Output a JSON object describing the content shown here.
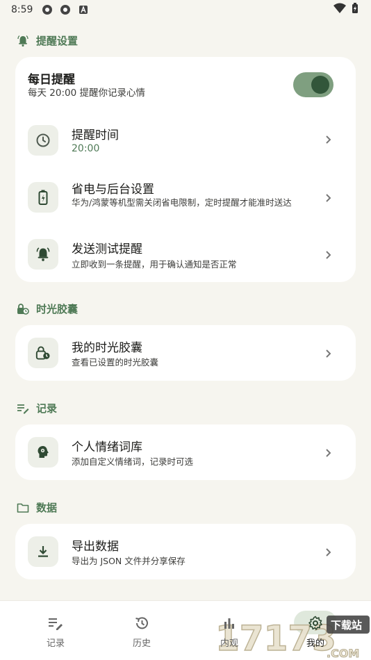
{
  "status_bar": {
    "time": "8:59"
  },
  "sections": {
    "reminder": {
      "header": "提醒设置"
    },
    "capsule": {
      "header": "时光胶囊"
    },
    "record": {
      "header": "记录"
    },
    "data": {
      "header": "数据"
    }
  },
  "daily_reminder": {
    "title": "每日提醒",
    "subtitle": "每天 20:00 提醒你记录心情",
    "enabled": true
  },
  "reminder_rows": [
    {
      "title": "提醒时间",
      "subtitle": "20:00",
      "icon": "clock-icon"
    },
    {
      "title": "省电与后台设置",
      "subtitle": "华为/鸿蒙等机型需关闭省电限制，定时提醒才能准时送达",
      "icon": "battery-icon"
    },
    {
      "title": "发送测试提醒",
      "subtitle": "立即收到一条提醒，用于确认通知是否正常",
      "icon": "bell-ring-icon"
    }
  ],
  "capsule_rows": [
    {
      "title": "我的时光胶囊",
      "subtitle": "查看已设置的时光胶囊",
      "icon": "lock-clock-icon"
    }
  ],
  "record_rows": [
    {
      "title": "个人情绪词库",
      "subtitle": "添加自定义情绪词，记录时可选",
      "icon": "head-icon"
    }
  ],
  "data_rows": [
    {
      "title": "导出数据",
      "subtitle": "导出为 JSON 文件并分享保存",
      "icon": "download-icon"
    }
  ],
  "bottom_nav": {
    "items": [
      {
        "label": "记录",
        "icon": "edit-list-icon"
      },
      {
        "label": "历史",
        "icon": "history-icon"
      },
      {
        "label": "内观",
        "icon": "chart-icon"
      },
      {
        "label": "我的",
        "icon": "gear-icon"
      }
    ],
    "active_index": 3
  },
  "watermark": {
    "number": "17173",
    "domain": ".COM",
    "label": "下载站"
  },
  "colors": {
    "accent": "#4f7a56",
    "background": "#f6f5ef",
    "card": "#ffffff",
    "toggle_track": "#7f9f80",
    "toggle_knob": "#32563a"
  }
}
